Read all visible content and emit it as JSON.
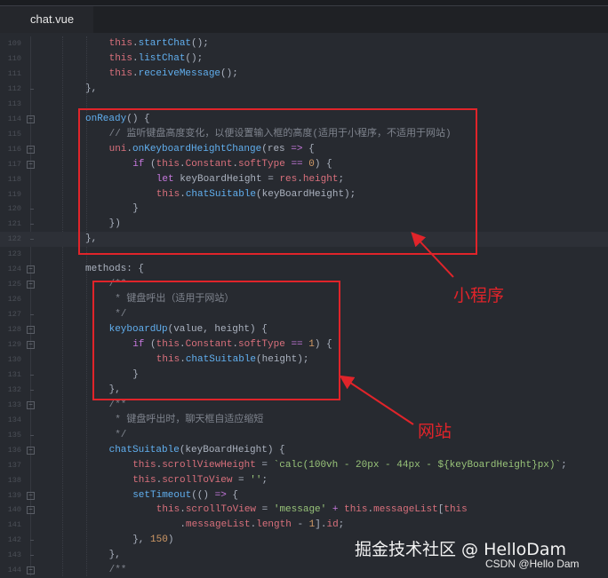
{
  "tab": {
    "label": "chat.vue"
  },
  "colors": {
    "annotation": "#e0242a",
    "background": "#272a30"
  },
  "annotations": {
    "mini_program": "小程序",
    "website": "网站"
  },
  "watermark": {
    "primary": "掘金技术社区 @ HelloDam",
    "secondary": "CSDN @Hello Dam"
  },
  "lines": [
    {
      "n": "109",
      "indent": 1,
      "mark": "",
      "t": [
        [
          "this",
          "this"
        ],
        [
          "p",
          "."
        ],
        [
          "fn",
          "startChat"
        ],
        [
          "p",
          "();"
        ]
      ]
    },
    {
      "n": "110",
      "indent": 1,
      "mark": "",
      "t": [
        [
          "this",
          "this"
        ],
        [
          "p",
          "."
        ],
        [
          "fn",
          "listChat"
        ],
        [
          "p",
          "();"
        ]
      ]
    },
    {
      "n": "111",
      "indent": 1,
      "mark": "",
      "t": [
        [
          "this",
          "this"
        ],
        [
          "p",
          "."
        ],
        [
          "fn",
          "receiveMessage"
        ],
        [
          "p",
          "();"
        ]
      ]
    },
    {
      "n": "112",
      "indent": 0,
      "mark": "end",
      "t": [
        [
          "p",
          "},"
        ]
      ]
    },
    {
      "n": "113",
      "indent": 0,
      "mark": "",
      "t": []
    },
    {
      "n": "114",
      "indent": 0,
      "mark": "fold",
      "t": [
        [
          "fn",
          "onReady"
        ],
        [
          "p",
          "() {"
        ]
      ]
    },
    {
      "n": "115",
      "indent": 1,
      "mark": "",
      "t": [
        [
          "cm",
          "// 监听键盘高度变化，以便设置输入框的高度(适用于小程序，不适用于网站)"
        ]
      ]
    },
    {
      "n": "116",
      "indent": 1,
      "mark": "fold",
      "t": [
        [
          "this",
          "uni"
        ],
        [
          "p",
          "."
        ],
        [
          "fn",
          "onKeyboardHeightChange"
        ],
        [
          "p",
          "(res "
        ],
        [
          "kw",
          "=>"
        ],
        [
          "p",
          " {"
        ]
      ]
    },
    {
      "n": "117",
      "indent": 2,
      "mark": "fold",
      "t": [
        [
          "kw",
          "if"
        ],
        [
          "p",
          " ("
        ],
        [
          "this",
          "this"
        ],
        [
          "p",
          "."
        ],
        [
          "prop",
          "Constant"
        ],
        [
          "p",
          "."
        ],
        [
          "prop",
          "softType"
        ],
        [
          "p",
          " "
        ],
        [
          "kw",
          "=="
        ],
        [
          "p",
          " "
        ],
        [
          "num",
          "0"
        ],
        [
          "p",
          ") {"
        ]
      ]
    },
    {
      "n": "118",
      "indent": 3,
      "mark": "",
      "t": [
        [
          "kw",
          "let"
        ],
        [
          "p",
          " keyBoardHeight = "
        ],
        [
          "this",
          "res"
        ],
        [
          "p",
          "."
        ],
        [
          "prop",
          "height"
        ],
        [
          "p",
          ";"
        ]
      ]
    },
    {
      "n": "119",
      "indent": 3,
      "mark": "",
      "t": [
        [
          "this",
          "this"
        ],
        [
          "p",
          "."
        ],
        [
          "fn",
          "chatSuitable"
        ],
        [
          "p",
          "(keyBoardHeight);"
        ]
      ]
    },
    {
      "n": "120",
      "indent": 2,
      "mark": "end",
      "t": [
        [
          "p",
          "}"
        ]
      ]
    },
    {
      "n": "121",
      "indent": 1,
      "mark": "end",
      "t": [
        [
          "p",
          "})"
        ]
      ]
    },
    {
      "n": "122",
      "indent": 0,
      "mark": "end",
      "current": true,
      "t": [
        [
          "p",
          "},"
        ]
      ]
    },
    {
      "n": "123",
      "indent": 0,
      "mark": "",
      "t": []
    },
    {
      "n": "124",
      "indent": 0,
      "mark": "fold",
      "t": [
        [
          "p",
          "methods: {"
        ]
      ]
    },
    {
      "n": "125",
      "indent": 1,
      "mark": "fold",
      "t": [
        [
          "cm",
          "/**"
        ]
      ]
    },
    {
      "n": "126",
      "indent": 1,
      "mark": "",
      "t": [
        [
          "cm",
          " * 键盘呼出（适用于网站）"
        ]
      ]
    },
    {
      "n": "127",
      "indent": 1,
      "mark": "end",
      "t": [
        [
          "cm",
          " */"
        ]
      ]
    },
    {
      "n": "128",
      "indent": 1,
      "mark": "fold",
      "t": [
        [
          "fn",
          "keyboardUp"
        ],
        [
          "p",
          "(value, height) {"
        ]
      ]
    },
    {
      "n": "129",
      "indent": 2,
      "mark": "fold",
      "t": [
        [
          "kw",
          "if"
        ],
        [
          "p",
          " ("
        ],
        [
          "this",
          "this"
        ],
        [
          "p",
          "."
        ],
        [
          "prop",
          "Constant"
        ],
        [
          "p",
          "."
        ],
        [
          "prop",
          "softType"
        ],
        [
          "p",
          " "
        ],
        [
          "kw",
          "=="
        ],
        [
          "p",
          " "
        ],
        [
          "num",
          "1"
        ],
        [
          "p",
          ") {"
        ]
      ]
    },
    {
      "n": "130",
      "indent": 3,
      "mark": "",
      "t": [
        [
          "this",
          "this"
        ],
        [
          "p",
          "."
        ],
        [
          "fn",
          "chatSuitable"
        ],
        [
          "p",
          "(height);"
        ]
      ]
    },
    {
      "n": "131",
      "indent": 2,
      "mark": "end",
      "t": [
        [
          "p",
          "}"
        ]
      ]
    },
    {
      "n": "132",
      "indent": 1,
      "mark": "end",
      "t": [
        [
          "p",
          "},"
        ]
      ]
    },
    {
      "n": "133",
      "indent": 1,
      "mark": "fold",
      "t": [
        [
          "cm",
          "/**"
        ]
      ]
    },
    {
      "n": "134",
      "indent": 1,
      "mark": "",
      "t": [
        [
          "cm",
          " * 键盘呼出时，聊天框自适应缩短"
        ]
      ]
    },
    {
      "n": "135",
      "indent": 1,
      "mark": "end",
      "t": [
        [
          "cm",
          " */"
        ]
      ]
    },
    {
      "n": "136",
      "indent": 1,
      "mark": "fold",
      "t": [
        [
          "fn",
          "chatSuitable"
        ],
        [
          "p",
          "(keyBoardHeight) {"
        ]
      ]
    },
    {
      "n": "137",
      "indent": 2,
      "mark": "",
      "t": [
        [
          "this",
          "this"
        ],
        [
          "p",
          "."
        ],
        [
          "prop",
          "scrollViewHeight"
        ],
        [
          "p",
          " = "
        ],
        [
          "str",
          "`calc(100vh - 20px - 44px - ${keyBoardHeight}px)`"
        ],
        [
          "p",
          ";"
        ]
      ]
    },
    {
      "n": "138",
      "indent": 2,
      "mark": "",
      "t": [
        [
          "this",
          "this"
        ],
        [
          "p",
          "."
        ],
        [
          "prop",
          "scrollToView"
        ],
        [
          "p",
          " = "
        ],
        [
          "str",
          "''"
        ],
        [
          "p",
          ";"
        ]
      ]
    },
    {
      "n": "139",
      "indent": 2,
      "mark": "fold",
      "t": [
        [
          "fn",
          "setTimeout"
        ],
        [
          "p",
          "(() "
        ],
        [
          "kw",
          "=>"
        ],
        [
          "p",
          " {"
        ]
      ]
    },
    {
      "n": "140",
      "indent": 3,
      "mark": "fold",
      "t": [
        [
          "this",
          "this"
        ],
        [
          "p",
          "."
        ],
        [
          "prop",
          "scrollToView"
        ],
        [
          "p",
          " = "
        ],
        [
          "str",
          "'message'"
        ],
        [
          "p",
          " "
        ],
        [
          "kw",
          "+"
        ],
        [
          "p",
          " "
        ],
        [
          "this",
          "this"
        ],
        [
          "p",
          "."
        ],
        [
          "prop",
          "messageList"
        ],
        [
          "p",
          "["
        ],
        [
          "this",
          "this"
        ]
      ]
    },
    {
      "n": "141",
      "indent": 4,
      "mark": "",
      "t": [
        [
          "p",
          "."
        ],
        [
          "prop",
          "messageList"
        ],
        [
          "p",
          "."
        ],
        [
          "prop",
          "length"
        ],
        [
          "p",
          " - "
        ],
        [
          "num",
          "1"
        ],
        [
          "p",
          "]."
        ],
        [
          "prop",
          "id"
        ],
        [
          "p",
          ";"
        ]
      ]
    },
    {
      "n": "142",
      "indent": 2,
      "mark": "end",
      "t": [
        [
          "p",
          "}, "
        ],
        [
          "num",
          "150"
        ],
        [
          "p",
          ")"
        ]
      ]
    },
    {
      "n": "143",
      "indent": 1,
      "mark": "end",
      "t": [
        [
          "p",
          "},"
        ]
      ]
    },
    {
      "n": "144",
      "indent": 1,
      "mark": "fold",
      "t": [
        [
          "cm",
          "/**"
        ]
      ]
    }
  ]
}
